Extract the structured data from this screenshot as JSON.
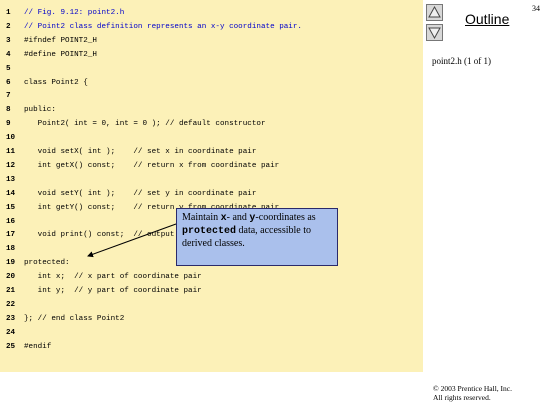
{
  "slide": {
    "number": "34",
    "outline_title": "Outline",
    "file_label": "point2.h (1 of 1)",
    "copyright_line1": "© 2003 Prentice Hall, Inc.",
    "copyright_line2": "All rights reserved."
  },
  "code_lines": [
    {
      "num": "1",
      "text": "// Fig. 9.12: point2.h",
      "kw": false
    },
    {
      "num": "2",
      "text": "// Point2 class definition represents an x-y coordinate pair.",
      "kw": false
    },
    {
      "num": "3",
      "text": "#ifndef POINT2_H",
      "kw": true
    },
    {
      "num": "4",
      "text": "#define POINT2_H",
      "kw": true
    },
    {
      "num": "5",
      "text": "",
      "kw": false
    },
    {
      "num": "6",
      "text": "class Point2 {",
      "kw": true
    },
    {
      "num": "7",
      "text": "",
      "kw": false
    },
    {
      "num": "8",
      "text": "public:",
      "kw": true
    },
    {
      "num": "9",
      "text": "   Point2( int = 0, int = 0 ); // default constructor",
      "kw": true
    },
    {
      "num": "10",
      "text": "",
      "kw": false
    },
    {
      "num": "11",
      "text": "   void setX( int );    // set x in coordinate pair",
      "kw": true
    },
    {
      "num": "12",
      "text": "   int getX() const;    // return x from coordinate pair",
      "kw": true
    },
    {
      "num": "13",
      "text": "",
      "kw": false
    },
    {
      "num": "14",
      "text": "   void setY( int );    // set y in coordinate pair",
      "kw": true
    },
    {
      "num": "15",
      "text": "   int getY() const;    // return y from coordinate pair",
      "kw": true
    },
    {
      "num": "16",
      "text": "",
      "kw": false
    },
    {
      "num": "17",
      "text": "   void print() const;  // output Point2 object",
      "kw": true
    },
    {
      "num": "18",
      "text": "",
      "kw": false
    },
    {
      "num": "19",
      "text": "protected:",
      "kw": true
    },
    {
      "num": "20",
      "text": "   int x;  // x part of coordinate pair",
      "kw": true
    },
    {
      "num": "21",
      "text": "   int y;  // y part of coordinate pair",
      "kw": true
    },
    {
      "num": "22",
      "text": "",
      "kw": false
    },
    {
      "num": "23",
      "text": "}; // end class Point2",
      "kw": true
    },
    {
      "num": "24",
      "text": "",
      "kw": false
    },
    {
      "num": "25",
      "text": "#endif",
      "kw": true
    }
  ],
  "callout": {
    "part1": "Maintain ",
    "x": "x",
    "part2": "- and ",
    "y": "y",
    "part3": "-coordinates as ",
    "protected": "protected",
    "part4": " data, accessible to derived classes."
  },
  "colors": {
    "code_background": "#fcf1b8",
    "callout_background": "#aac0ec",
    "comment_text": "#0000cc"
  },
  "icons": {
    "up": "arrow-up-icon",
    "down": "arrow-down-icon"
  }
}
